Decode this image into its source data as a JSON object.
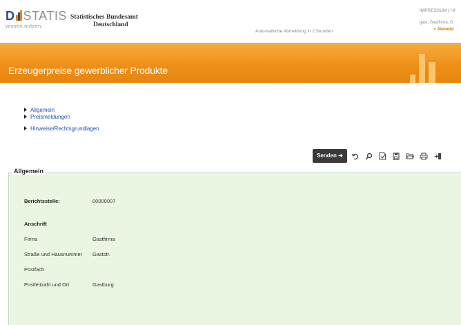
{
  "header": {
    "logo_prefix": "D",
    "logo_suffix": "STATIS",
    "logo_tagline": "wissen.nutzen.",
    "agency_line1": "Statistisches Bundesamt",
    "agency_line2": "Deutschland",
    "auto_logout": "Automatische Abmeldung in 2 Stunden",
    "top_links": "IMPRESSUM | HI",
    "user_info": "gast, Gastfirma, G",
    "logout_label": "+ Abmeld"
  },
  "banner": {
    "title": "Erzeugerpreise gewerblicher Produkte"
  },
  "nav": {
    "items": [
      {
        "label": "Allgemein"
      },
      {
        "label": "Preismeldungen"
      },
      {
        "label": "Hinweise/Rechtsgrundlagen"
      }
    ]
  },
  "toolbar": {
    "send_label": "Senden",
    "icons": [
      "send-arrow-icon",
      "undo-icon",
      "search-icon",
      "check-document-icon",
      "save-icon",
      "open-folder-icon",
      "print-icon",
      "exit-icon"
    ]
  },
  "form": {
    "section_title": "Allgemein",
    "reporting_label": "Berichtsstelle:",
    "reporting_value": "00000007",
    "address_heading": "Anschrift",
    "fields": [
      {
        "label": "Firma",
        "value": "Gastfirma"
      },
      {
        "label": "Straße und Hausnummer",
        "value": "Gaststr."
      },
      {
        "label": "Postfach",
        "value": ""
      },
      {
        "label": "Postleitzahl und Ort",
        "value": "Gastburg"
      }
    ]
  },
  "colors": {
    "banner_orange": "#ec8e16",
    "panel_green": "#eaf6e2",
    "link_blue": "#1a4fae",
    "logo_blue": "#2a4d8f"
  }
}
